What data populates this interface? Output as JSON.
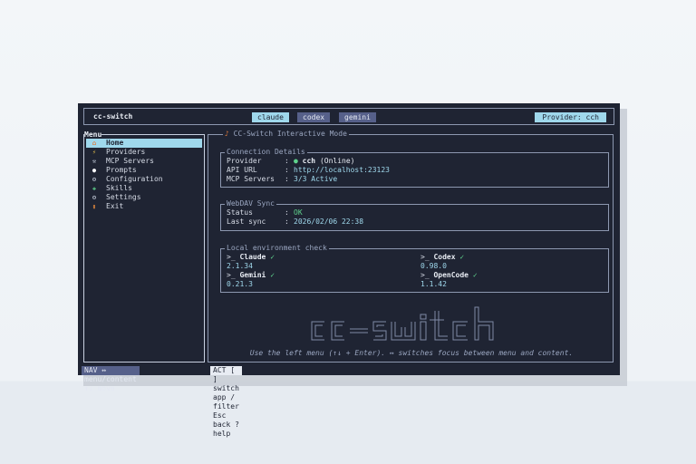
{
  "header": {
    "app_name": "cc-switch",
    "tabs": [
      {
        "label": "claude",
        "active": true
      },
      {
        "label": "codex",
        "active": false
      },
      {
        "label": "gemini",
        "active": false
      }
    ],
    "provider_badge": "Provider: cch"
  },
  "menu": {
    "title": "Menu",
    "items": [
      {
        "icon": "home-icon",
        "glyph": "⌂",
        "label": "Home",
        "selected": true
      },
      {
        "icon": "plug-icon",
        "glyph": "⚡",
        "label": "Providers",
        "selected": false
      },
      {
        "icon": "hammer-icon",
        "glyph": "⚒",
        "label": "MCP Servers",
        "selected": false
      },
      {
        "icon": "speech-bubble-icon",
        "glyph": "●",
        "label": "Prompts",
        "selected": false
      },
      {
        "icon": "gear-icon",
        "glyph": "⚙",
        "label": "Configuration",
        "selected": false
      },
      {
        "icon": "puzzle-icon",
        "glyph": "✚",
        "label": "Skills",
        "selected": false
      },
      {
        "icon": "settings-icon",
        "glyph": "⚙",
        "label": "Settings",
        "selected": false
      },
      {
        "icon": "door-icon",
        "glyph": "▮",
        "label": "Exit",
        "selected": false
      }
    ]
  },
  "content": {
    "title_icon": "guitar-icon",
    "title": "CC-Switch Interactive Mode",
    "connection": {
      "title": "Connection Details",
      "rows": [
        {
          "key": "Provider",
          "sep": ":",
          "value": "cch",
          "suffix": "(Online)"
        },
        {
          "key": "API URL",
          "sep": ":",
          "value": "http://localhost:23123"
        },
        {
          "key": "MCP Servers",
          "sep": ":",
          "value": "3/3 Active"
        }
      ]
    },
    "webdav": {
      "title": "WebDAV Sync",
      "rows": [
        {
          "key": "Status",
          "sep": ":",
          "value": "OK"
        },
        {
          "key": "Last sync",
          "sep": ":",
          "value": "2026/02/06 22:38"
        }
      ]
    },
    "env": {
      "title": "Local environment check",
      "prompt": ">_",
      "check": "✓",
      "tools": [
        {
          "name": "Claude",
          "version": "2.1.34"
        },
        {
          "name": "Codex",
          "version": "0.98.0"
        },
        {
          "name": "Gemini",
          "version": "0.21.3"
        },
        {
          "name": "OpenCode",
          "version": "1.1.42"
        }
      ]
    },
    "hint": "Use the left menu (↑↓ + Enter). ↔ switches focus between menu and content."
  },
  "statusbar": {
    "nav": "NAV ↔ menu/content  ↑↓ move",
    "act": "ACT [ ] switch app  / filter  Esc back  ? help"
  },
  "colors": {
    "background": "#1f2433",
    "accent": "#9fd8ec",
    "inactive_tab": "#56608a",
    "online": "#5fd38d"
  }
}
